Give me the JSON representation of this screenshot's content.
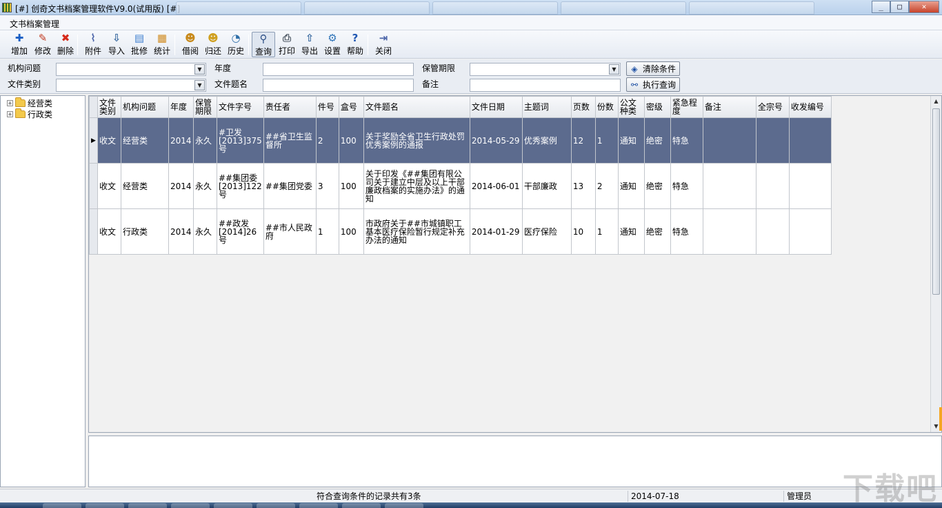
{
  "window": {
    "title": "[#] 创奇文书档案管理软件V9.0(试用版) [#]"
  },
  "menu": {
    "items": [
      "文书档案管理"
    ]
  },
  "toolbar": {
    "buttons": [
      {
        "label": "增加",
        "icon": "plus-icon",
        "glyph": "✚",
        "color": "#1a5fc4"
      },
      {
        "label": "修改",
        "icon": "pencil-icon",
        "glyph": "✎",
        "color": "#c23b22"
      },
      {
        "label": "删除",
        "icon": "delete-x-icon",
        "glyph": "✖",
        "color": "#d62a1a"
      },
      {
        "label": "附件",
        "icon": "paperclip-icon",
        "glyph": "⌇",
        "color": "#4a63a8"
      },
      {
        "label": "导入",
        "icon": "import-icon",
        "glyph": "⇩",
        "color": "#3a6aa0"
      },
      {
        "label": "批修",
        "icon": "batch-edit-icon",
        "glyph": "▤",
        "color": "#3f7fcf"
      },
      {
        "label": "统计",
        "icon": "statistics-icon",
        "glyph": "▦",
        "color": "#d08a1e"
      },
      {
        "label": "借阅",
        "icon": "borrow-icon",
        "glyph": "☻",
        "color": "#c88a1c"
      },
      {
        "label": "归还",
        "icon": "return-icon",
        "glyph": "☻",
        "color": "#d0a020"
      },
      {
        "label": "历史",
        "icon": "clock-icon",
        "glyph": "◔",
        "color": "#2f6fa8"
      },
      {
        "label": "查询",
        "icon": "search-icon",
        "glyph": "⚲",
        "color": "#2d4f86"
      },
      {
        "label": "打印",
        "icon": "printer-icon",
        "glyph": "⎙",
        "color": "#505a66"
      },
      {
        "label": "导出",
        "icon": "export-icon",
        "glyph": "⇧",
        "color": "#3a6aa0"
      },
      {
        "label": "设置",
        "icon": "gear-icon",
        "glyph": "⚙",
        "color": "#2f74b8"
      },
      {
        "label": "帮助",
        "icon": "help-icon",
        "glyph": "?",
        "color": "#2259b3"
      },
      {
        "label": "关闭",
        "icon": "exit-icon",
        "glyph": "⇥",
        "color": "#4a63a8"
      }
    ]
  },
  "filters": {
    "org_label": "机构问题",
    "year_label": "年度",
    "retention_label": "保管期限",
    "doctype_label": "文件类别",
    "doctitle_label": "文件题名",
    "note_label": "备注",
    "clear_button": "清除条件",
    "search_button": "执行查询"
  },
  "tree": {
    "nodes": [
      "经营类",
      "行政类"
    ]
  },
  "grid": {
    "columns": [
      "文件类别",
      "机构问题",
      "年度",
      "保管期限",
      "文件字号",
      "责任者",
      "件号",
      "盒号",
      "文件题名",
      "文件日期",
      "主题词",
      "页数",
      "份数",
      "公文种类",
      "密级",
      "紧急程度",
      "备注",
      "全宗号",
      "收发编号"
    ],
    "rows": [
      [
        "收文",
        "经营类",
        "2014",
        "永久",
        "#卫发[2013]375号",
        "##省卫生监督所",
        "2",
        "100",
        "关于奖励全省卫生行政处罚优秀案例的通报",
        "2014-05-29",
        "优秀案例",
        "12",
        "1",
        "通知",
        "绝密",
        "特急",
        "",
        "",
        ""
      ],
      [
        "收文",
        "经营类",
        "2014",
        "永久",
        "##集团委[2013]122号",
        "##集团党委",
        "3",
        "100",
        "关于印发《##集团有限公司关于建立中层及以上干部廉政档案的实施办法》的通知",
        "2014-06-01",
        "干部廉政",
        "13",
        "2",
        "通知",
        "绝密",
        "特急",
        "",
        "",
        ""
      ],
      [
        "收文",
        "行政类",
        "2014",
        "永久",
        "##政发[2014]26号",
        "##市人民政府",
        "1",
        "100",
        "市政府关于##市城镇职工基本医疗保险暂行规定补充办法的通知",
        "2014-01-29",
        "医疗保险",
        "10",
        "1",
        "通知",
        "绝密",
        "特急",
        "",
        "",
        ""
      ]
    ],
    "selected_row": 0
  },
  "statusbar": {
    "message": "符合查询条件的记录共有3条",
    "date": "2014-07-18",
    "user": "管理员"
  },
  "watermark": "下载吧"
}
